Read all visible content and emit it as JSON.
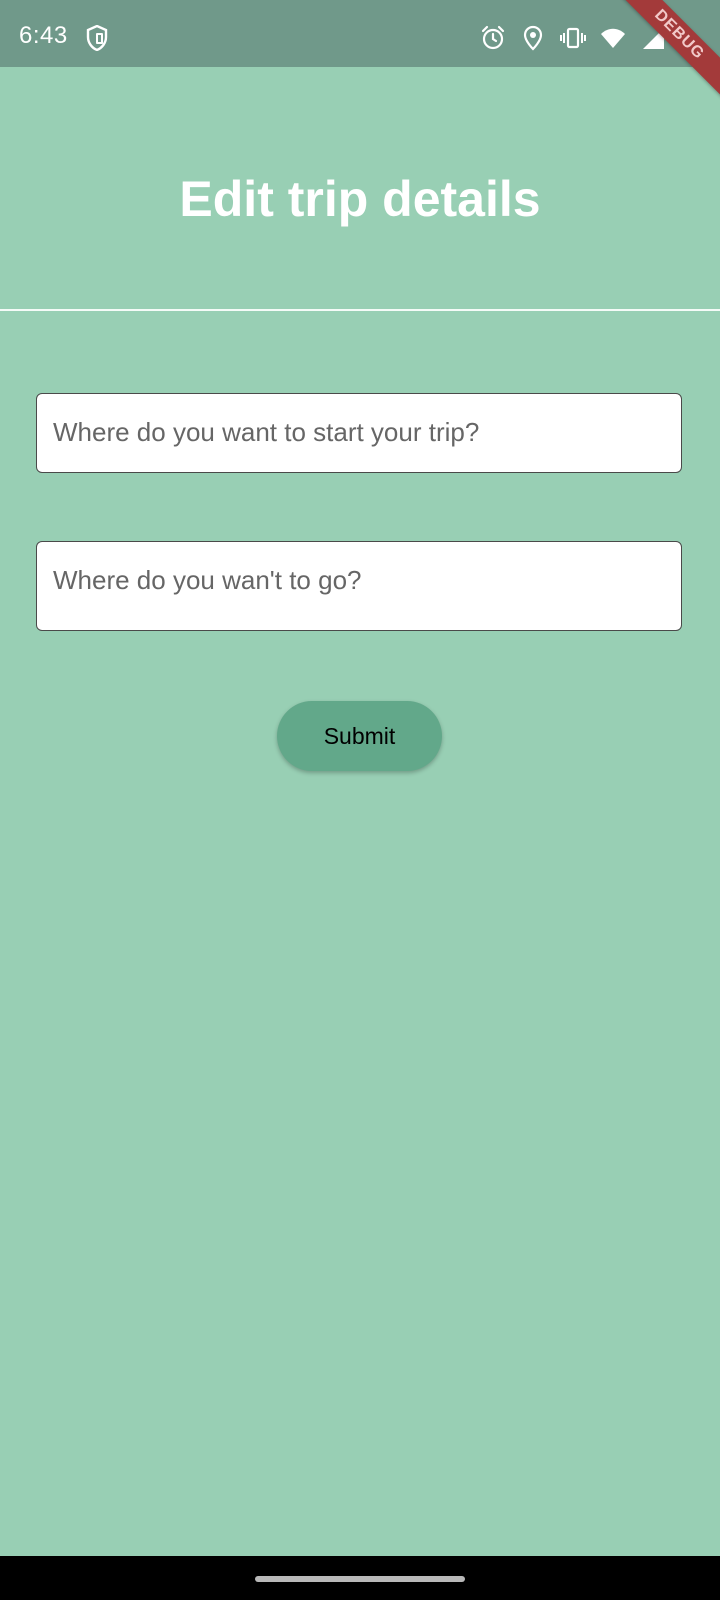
{
  "status_bar": {
    "time": "6:43",
    "icons": [
      "shield-icon",
      "alarm-icon",
      "location-icon",
      "vibrate-icon",
      "wifi-icon",
      "signal-icon",
      "battery-icon"
    ],
    "debug_label": "DEBUG"
  },
  "header": {
    "title": "Edit trip details"
  },
  "form": {
    "start": {
      "value": "",
      "placeholder": "Where do you want to start your trip?"
    },
    "destination": {
      "value": "",
      "placeholder": "Where do you wan't to go?"
    },
    "submit_label": "Submit"
  },
  "colors": {
    "background": "#98cfb4",
    "status_bar": "#70998a",
    "button": "#62a88a",
    "title_text": "#ffffff",
    "debug_banner": "#a33a3a"
  }
}
